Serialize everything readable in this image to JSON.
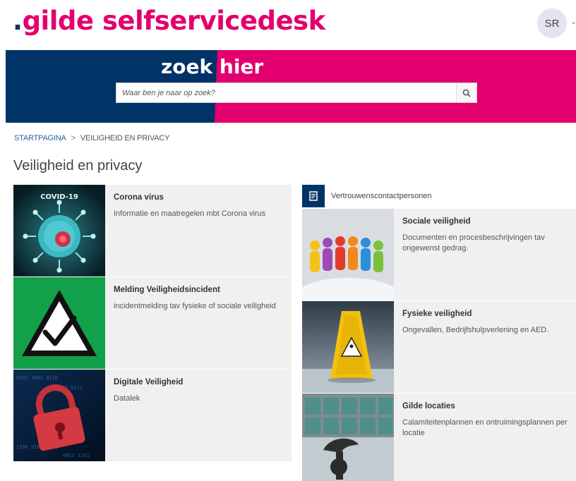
{
  "header": {
    "logo_dot": ".",
    "logo_text": "gilde selfservicedesk",
    "avatar_initials": "SR",
    "avatar_caret": "⌄"
  },
  "hero": {
    "title_part1": "zoek ",
    "title_part2": "hier",
    "search_placeholder": "Waar ben je naar op zoek?"
  },
  "breadcrumb": {
    "home": "STARTPAGINA",
    "separator": ">",
    "current": "VEILIGHEID EN PRIVACY"
  },
  "page_title": "Veiligheid en privacy",
  "left_cards": [
    {
      "title": "Corona virus",
      "description": "Informatie en maatregelen mbt Corona virus",
      "thumb_caption": "COVID-19"
    },
    {
      "title": "Melding Veiligheidsincident",
      "description": "incidentmelding tav fysieke of sociale veiligheid"
    },
    {
      "title": "Digitale Veiligheid",
      "description": "Datalek"
    }
  ],
  "right_header": {
    "label": "Vertrouwenscontactpersonen"
  },
  "right_cards": [
    {
      "title": "Sociale veiligheid",
      "description": "Documenten en procesbeschrijvingen tav ongewenst gedrag."
    },
    {
      "title": "Fysieke veiligheid",
      "description": "Ongevallen, Bedrijfshulpverlening en AED."
    },
    {
      "title": "Gilde locaties",
      "description": "Calamiteitenplannen en ontruimingsplannen per locatie"
    }
  ],
  "colors": {
    "brand_navy": "#003366",
    "brand_magenta": "#e3006e",
    "card_bg": "#f0f0f0"
  }
}
